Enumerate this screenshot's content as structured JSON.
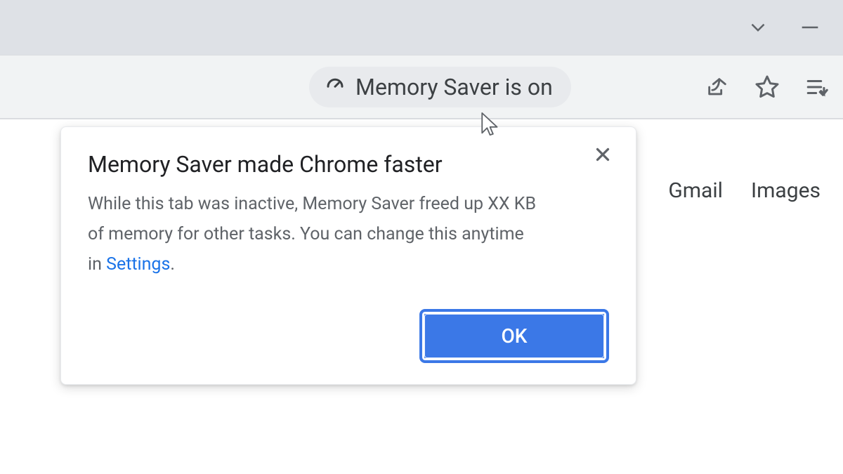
{
  "omnibox_chip": {
    "label": "Memory Saver is on"
  },
  "page_links": {
    "gmail": "Gmail",
    "images": "Images"
  },
  "popup": {
    "title": "Memory Saver made Chrome faster",
    "body_before_link": "While this tab was inactive, Memory Saver freed up XX KB of memory for other tasks. You can change this anytime in ",
    "settings_link": "Settings",
    "body_after_link": ".",
    "ok_label": "OK"
  }
}
